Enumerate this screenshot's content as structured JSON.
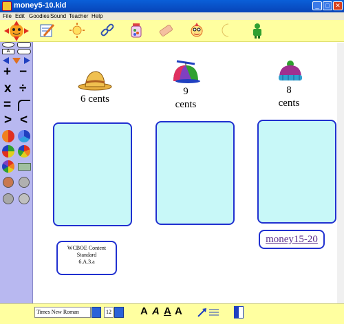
{
  "window": {
    "title": "money5-10.kid",
    "min": "_",
    "max": "□",
    "close": "✕"
  },
  "menu": [
    "File",
    "Edit",
    "Goodies",
    "Sound",
    "Teacher",
    "Help"
  ],
  "toolbar_icons": [
    "notepad-icon",
    "sun-icon",
    "chain-icon",
    "jar-icon",
    "eraser-icon",
    "face-icon",
    "moon-icon",
    "person-icon"
  ],
  "palette": {
    "ops": [
      "+",
      "−",
      "x",
      "÷",
      "=",
      ">",
      "<"
    ]
  },
  "items": [
    {
      "price": "6 cents"
    },
    {
      "price_num": "9",
      "price_unit": "cents"
    },
    {
      "price_num": "8",
      "price_unit": "cents"
    }
  ],
  "standard": {
    "line1": "WCBOE Content",
    "line2": "Standard",
    "line3": "6.A.3.a"
  },
  "link": {
    "label": "money15-20"
  },
  "bottom": {
    "font_name": "Times New Roman",
    "font_size": "12",
    "fmt": [
      "A",
      "A",
      "A",
      "A"
    ]
  },
  "colors": {
    "canvas_bg": "#ffffff",
    "box_fill": "#c8f8f8",
    "box_border": "#2030d0",
    "toolbar": "#ffffa0",
    "palette": "#b8b8f0"
  }
}
